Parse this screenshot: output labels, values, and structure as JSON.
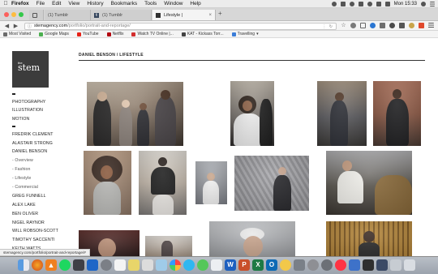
{
  "menubar": {
    "app": "Firefox",
    "items": [
      "File",
      "Edit",
      "View",
      "History",
      "Bookmarks",
      "Tools",
      "Window",
      "Help"
    ],
    "clock": "Mon 15:33"
  },
  "tabs": [
    {
      "label": "(1) Tumblr",
      "favicon": "tumblr-icon",
      "active": false
    },
    {
      "label": "(1) Tumblr",
      "favicon": "tumblr-icon",
      "active": false
    },
    {
      "label": "Lifestyle |",
      "favicon": "stem-icon",
      "active": true
    }
  ],
  "url": {
    "domain": "stemagency.com",
    "path": "/portfolio/portrait-and-reportage/"
  },
  "bookmarks": [
    {
      "label": "Most Visited",
      "color": "#6b6b6b"
    },
    {
      "label": "Google Maps",
      "color": "#4caf50"
    },
    {
      "label": "YouTube",
      "color": "#e62117"
    },
    {
      "label": "Netflix",
      "color": "#b20710"
    },
    {
      "label": "Watch TV Online |...",
      "color": "#d32f2f"
    },
    {
      "label": "KAT - Kickass Torr...",
      "color": "#444444"
    },
    {
      "label": "Travelling",
      "color": "#3b7dd8"
    }
  ],
  "logo": {
    "small": "the",
    "big": "stem"
  },
  "sidebar": {
    "group1": [
      "PHOTOGRAPHY",
      "ILLUSTRATION",
      "MOTION"
    ],
    "group2": [
      "FREDRIK CLEMENT",
      "ALASTAIR STRONG",
      "DANIEL BENSON",
      "- Overview",
      "- Fashion",
      "- Lifestyle",
      "- Commercial",
      "GREG FUNNELL",
      "ALEX LAKE",
      "BEN OLIVER",
      "NIGEL RAYNOR",
      "WILL ROBSON-SCOTT",
      "TIMOTHY SACCENTI",
      "KEITH WATTS"
    ]
  },
  "breadcrumb": "DANIEL BENSON / LIFESTYLE",
  "status_url": "stemagency.com/portfolio/portrait-and-reportage/#",
  "colors": {
    "menubar": "#ececec",
    "tabstrip": "#d7d7d7",
    "logo_bg": "#3c3c3c"
  }
}
